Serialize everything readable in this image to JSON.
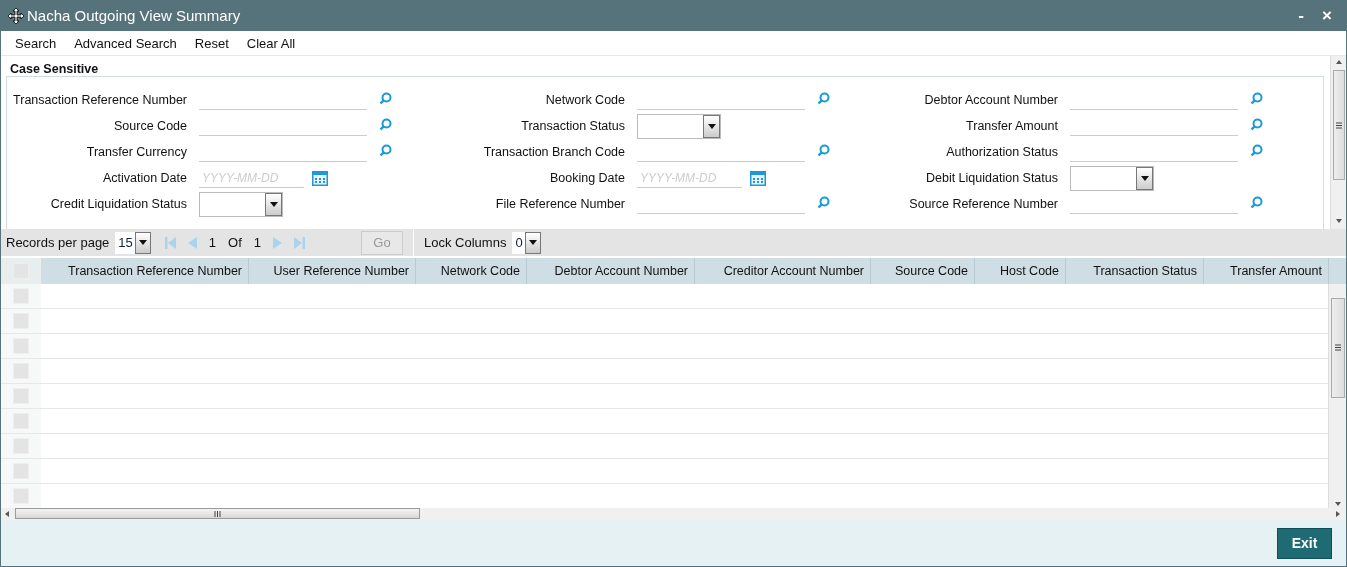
{
  "window": {
    "title": "Nacha Outgoing View Summary",
    "controls": [
      "-",
      "×"
    ]
  },
  "toolbar": [
    "Search",
    "Advanced Search",
    "Reset",
    "Clear All"
  ],
  "form": {
    "legend": "Case Sensitive",
    "columns": [
      [
        {
          "label": "Transaction Reference Number",
          "kind": "lookup"
        },
        {
          "label": "Source Code",
          "kind": "lookup"
        },
        {
          "label": "Transfer Currency",
          "kind": "lookup"
        },
        {
          "label": "Activation Date",
          "kind": "date",
          "placeholder": "YYYY-MM-DD"
        },
        {
          "label": "Credit Liquidation Status",
          "kind": "select"
        }
      ],
      [
        {
          "label": "Network Code",
          "kind": "lookup"
        },
        {
          "label": "Transaction Status",
          "kind": "select"
        },
        {
          "label": "Transaction Branch Code",
          "kind": "lookup"
        },
        {
          "label": "Booking Date",
          "kind": "date",
          "placeholder": "YYYY-MM-DD"
        },
        {
          "label": "File Reference Number",
          "kind": "lookup"
        }
      ],
      [
        {
          "label": "Debtor Account Number",
          "kind": "lookup"
        },
        {
          "label": "Transfer Amount",
          "kind": "lookup"
        },
        {
          "label": "Authorization Status",
          "kind": "lookup"
        },
        {
          "label": "Debit Liquidation Status",
          "kind": "select"
        },
        {
          "label": "Source Reference Number",
          "kind": "lookup"
        }
      ]
    ]
  },
  "pagination": {
    "records_label": "Records per page",
    "records_value": "15",
    "page": "1",
    "of": "Of",
    "total": "1",
    "go": "Go",
    "lock_label": "Lock Columns",
    "lock_value": "0"
  },
  "table": {
    "select_all": {
      "checked": false
    },
    "rows": [
      {
        "checked": false
      },
      {
        "checked": false
      },
      {
        "checked": false
      },
      {
        "checked": false
      },
      {
        "checked": false
      },
      {
        "checked": false
      },
      {
        "checked": false
      },
      {
        "checked": false
      },
      {
        "checked": false
      }
    ],
    "columns": [
      "Transaction Reference Number",
      "User Reference Number",
      "Network Code",
      "Debtor Account Number",
      "Creditor Account Number",
      "Source Code",
      "Host Code",
      "Transaction Status",
      "Transfer Amount"
    ]
  },
  "footer": {
    "exit": "Exit"
  }
}
